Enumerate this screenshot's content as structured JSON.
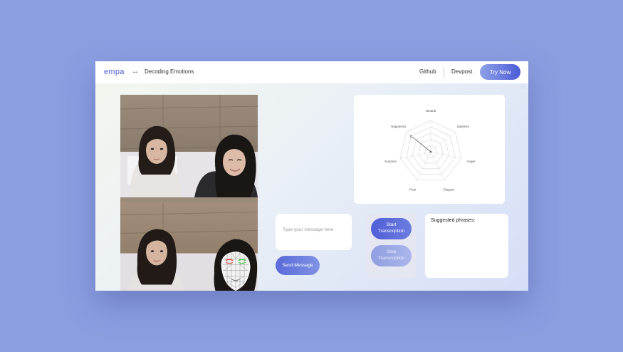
{
  "header": {
    "logo": "empa",
    "arrow_icon": "↔",
    "project_title": "Decoding Emotions",
    "nav": [
      {
        "label": "Github"
      },
      {
        "label": "Devpost"
      }
    ],
    "cta_label": "Try Now"
  },
  "radar": {
    "axes": [
      "Neutral",
      "Sadness",
      "Anger",
      "Disgust",
      "Fear",
      "Surprise",
      "Happiness"
    ]
  },
  "message": {
    "placeholder": "Type your message here",
    "send_label": "Send Message"
  },
  "transcription": {
    "start_line1": "Start",
    "start_line2": "Transcription",
    "stop_line1": "Stop",
    "stop_line2": "Transcription"
  },
  "phrases": {
    "title": "Suggested phrases:"
  },
  "colors": {
    "accent": "#4a5bd8",
    "page_background": "#8a9ee0",
    "face_mesh_brows_left": "#e05040",
    "face_mesh_brows_right": "#40d040"
  }
}
